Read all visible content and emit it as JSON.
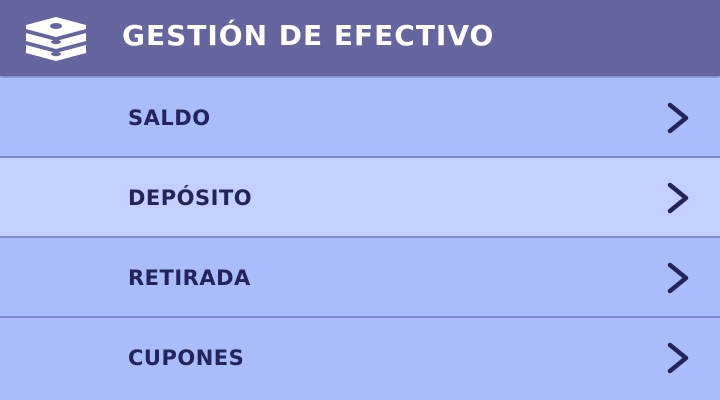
{
  "header": {
    "title": "GESTIÓN DE EFECTIVO",
    "icon": "cash-stack-icon",
    "background": "#6566a0"
  },
  "menu": {
    "items": [
      {
        "label": "SALDO",
        "icon": "chevron-right-icon",
        "background": "#a9bcfc"
      },
      {
        "label": "DEPÓSITO",
        "icon": "chevron-right-icon",
        "background": "#c4d0fe"
      },
      {
        "label": "RETIRADA",
        "icon": "chevron-right-icon",
        "background": "#a9bcfc"
      },
      {
        "label": "CUPONES",
        "icon": "chevron-right-icon",
        "background": "#a9bcfc"
      }
    ]
  },
  "colors": {
    "text_dark": "#22245a",
    "divider": "#7f88cf",
    "header_text": "#ffffff"
  }
}
